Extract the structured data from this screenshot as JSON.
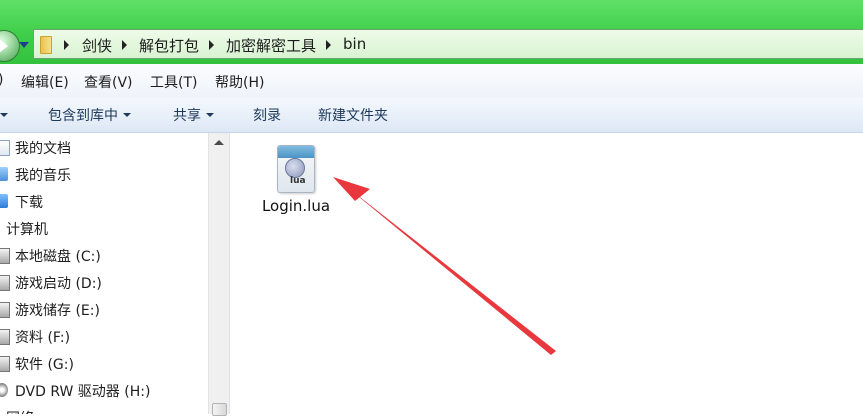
{
  "address": {
    "crumbs": [
      "剑侠",
      "解包打包",
      "加密解密工具",
      "bin"
    ]
  },
  "menu": {
    "items": [
      "编辑(E)",
      "查看(V)",
      "工具(T)",
      "帮助(H)"
    ],
    "partial_left": ")"
  },
  "toolbar": {
    "include_library": "包含到库中",
    "share": "共享",
    "burn": "刻录",
    "new_folder": "新建文件夹"
  },
  "nav": {
    "items": [
      {
        "label": "我的文档",
        "icon": "document-icon"
      },
      {
        "label": "我的音乐",
        "icon": "music-icon"
      },
      {
        "label": "下载",
        "icon": "download-icon"
      },
      {
        "label": "计算机",
        "icon": ""
      },
      {
        "label": "本地磁盘 (C:)",
        "icon": "drive-icon"
      },
      {
        "label": "游戏启动 (D:)",
        "icon": "drive-icon"
      },
      {
        "label": "游戏储存 (E:)",
        "icon": "drive-icon"
      },
      {
        "label": "资料 (F:)",
        "icon": "drive-icon"
      },
      {
        "label": "软件 (G:)",
        "icon": "drive-icon"
      },
      {
        "label": "DVD RW 驱动器 (H:)",
        "icon": "dvd-icon"
      },
      {
        "label": "网络",
        "icon": ""
      }
    ]
  },
  "files": [
    {
      "name": "Login.lua",
      "icon_text": "lua"
    }
  ],
  "colors": {
    "address_bar": "#3fce49",
    "annotation_arrow": "#e8383d"
  }
}
